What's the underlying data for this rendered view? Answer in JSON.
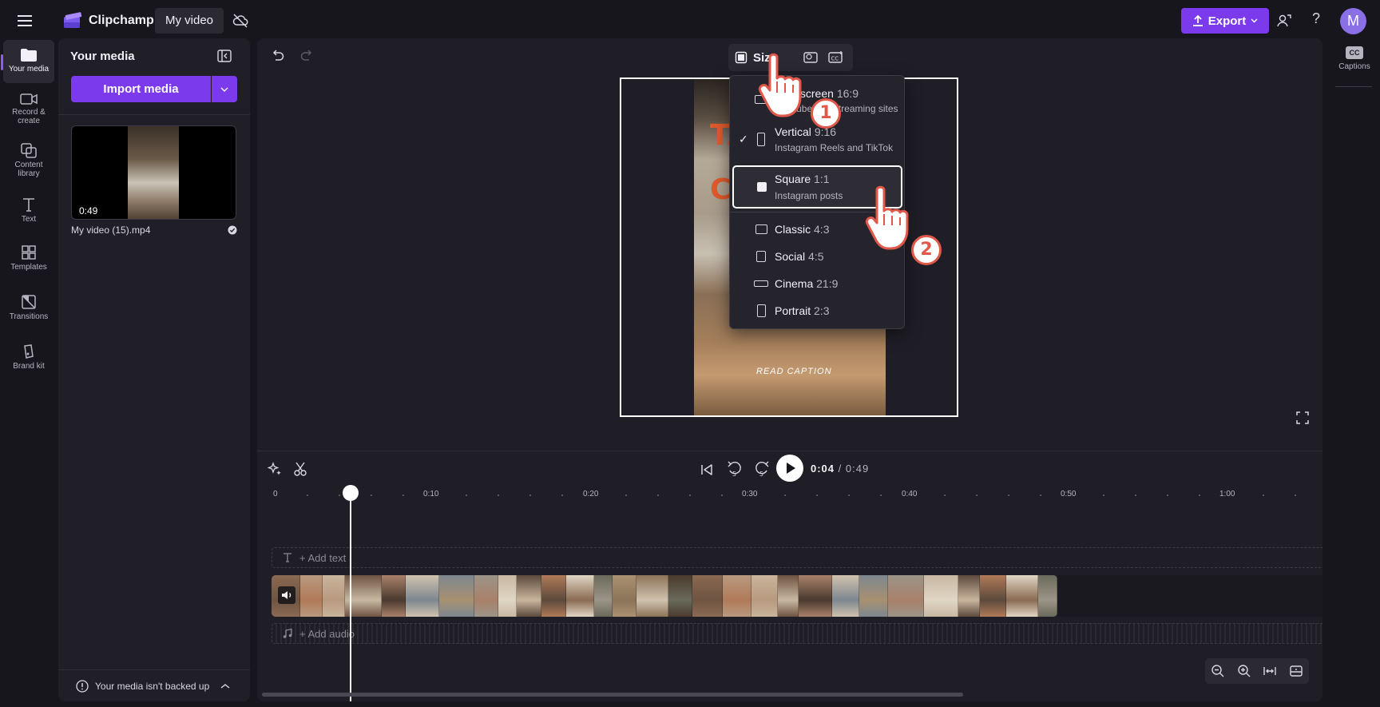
{
  "app": {
    "name": "Clipchamp",
    "project_name": "My video",
    "export_label": "Export",
    "avatar_initial": "M"
  },
  "rail": {
    "items": [
      {
        "label": "Your media",
        "icon": "folder-icon"
      },
      {
        "label": "Record & create",
        "icon": "camera-icon"
      },
      {
        "label": "Content library",
        "icon": "library-icon"
      },
      {
        "label": "Text",
        "icon": "text-icon"
      },
      {
        "label": "Templates",
        "icon": "templates-icon"
      },
      {
        "label": "Transitions",
        "icon": "transitions-icon"
      },
      {
        "label": "Brand kit",
        "icon": "brand-kit-icon"
      }
    ]
  },
  "media": {
    "title": "Your media",
    "import_label": "Import media",
    "file": {
      "name": "My video (15).mp4",
      "duration": "0:49"
    },
    "backup_text": "Your media isn't backed up"
  },
  "stage": {
    "size_label": "Size",
    "video_overlay_1": "TA",
    "video_overlay_2": "C",
    "video_caption": "READ CAPTION"
  },
  "size_menu": {
    "options": [
      {
        "name": "Widescreen",
        "ratio": "16:9",
        "sub": "YouTube and streaming sites",
        "checked": false
      },
      {
        "name": "Vertical",
        "ratio": "9:16",
        "sub": "Instagram Reels and TikTok",
        "checked": true
      },
      {
        "name": "Square",
        "ratio": "1:1",
        "sub": "Instagram posts",
        "checked": false
      },
      {
        "name": "Classic",
        "ratio": "4:3",
        "sub": "",
        "checked": false
      },
      {
        "name": "Social",
        "ratio": "4:5",
        "sub": "",
        "checked": false
      },
      {
        "name": "Cinema",
        "ratio": "21:9",
        "sub": "",
        "checked": false
      },
      {
        "name": "Portrait",
        "ratio": "2:3",
        "sub": "",
        "checked": false
      }
    ]
  },
  "steps": {
    "one": "1",
    "two": "2"
  },
  "right_rail": {
    "captions_label": "Captions",
    "captions_icon": "CC"
  },
  "timeline": {
    "current_time": "0:04",
    "total_time": "/ 0:49",
    "ticks": [
      "0",
      "0:10",
      "0:20",
      "0:30",
      "0:40",
      "0:50",
      "1:00"
    ],
    "add_text": "+ Add text",
    "add_audio": "+ Add audio",
    "skip_seconds": "5"
  },
  "colors": {
    "accent": "#7c3aed",
    "background": "#17161c",
    "panel": "#201f27",
    "badge_red": "#e0584a",
    "overlay_orange": "#e05a2b"
  }
}
